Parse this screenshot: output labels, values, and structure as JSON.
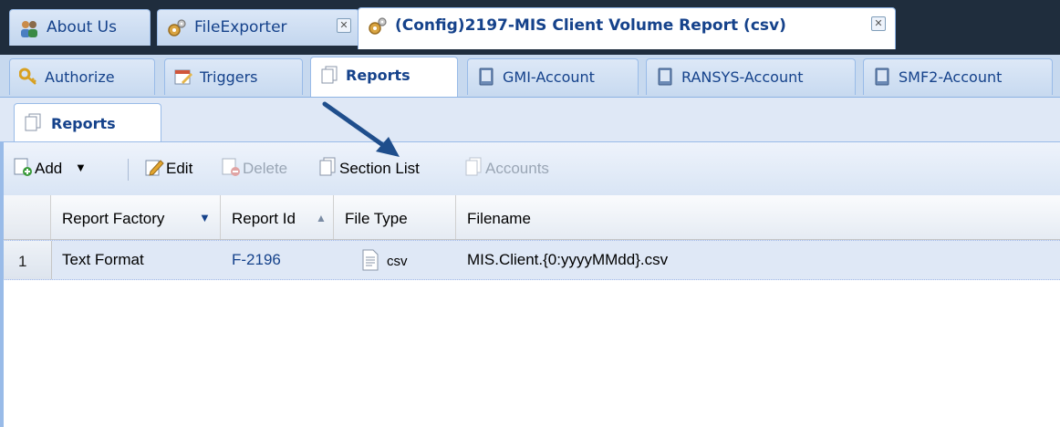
{
  "top_tabs": [
    {
      "label": "About Us",
      "icon": "group-icon",
      "closable": false,
      "active": false
    },
    {
      "label": "FileExporter",
      "icon": "gears-icon",
      "closable": true,
      "active": false
    },
    {
      "label": "(Config)2197-MIS Client Volume Report (csv)",
      "icon": "gears-icon",
      "closable": true,
      "active": true
    }
  ],
  "sub_tabs": [
    {
      "label": "Authorize",
      "icon": "key-icon",
      "active": false
    },
    {
      "label": "Triggers",
      "icon": "calendar-edit-icon",
      "active": false
    },
    {
      "label": "Reports",
      "icon": "pages-icon",
      "active": true
    },
    {
      "label": "GMI-Account",
      "icon": "server-icon",
      "active": false
    },
    {
      "label": "RANSYS-Account",
      "icon": "server-icon",
      "active": false
    },
    {
      "label": "SMF2-Account",
      "icon": "server-icon",
      "active": false
    }
  ],
  "inner_tab": {
    "label": "Reports",
    "icon": "pages-icon"
  },
  "toolbar": {
    "add_label": "Add",
    "edit_label": "Edit",
    "delete_label": "Delete",
    "section_list_label": "Section List",
    "accounts_label": "Accounts"
  },
  "grid": {
    "columns": [
      "Report Factory",
      "Report Id",
      "File Type",
      "Filename"
    ],
    "rows": [
      {
        "num": "1",
        "factory": "Text Format",
        "report_id": "F-2196",
        "file_type": "csv",
        "filename": "MIS.Client.{0:yyyyMMdd}.csv"
      }
    ]
  },
  "colors": {
    "accent": "#15428b",
    "link": "#15428b",
    "arrow": "#1f4e8c"
  }
}
